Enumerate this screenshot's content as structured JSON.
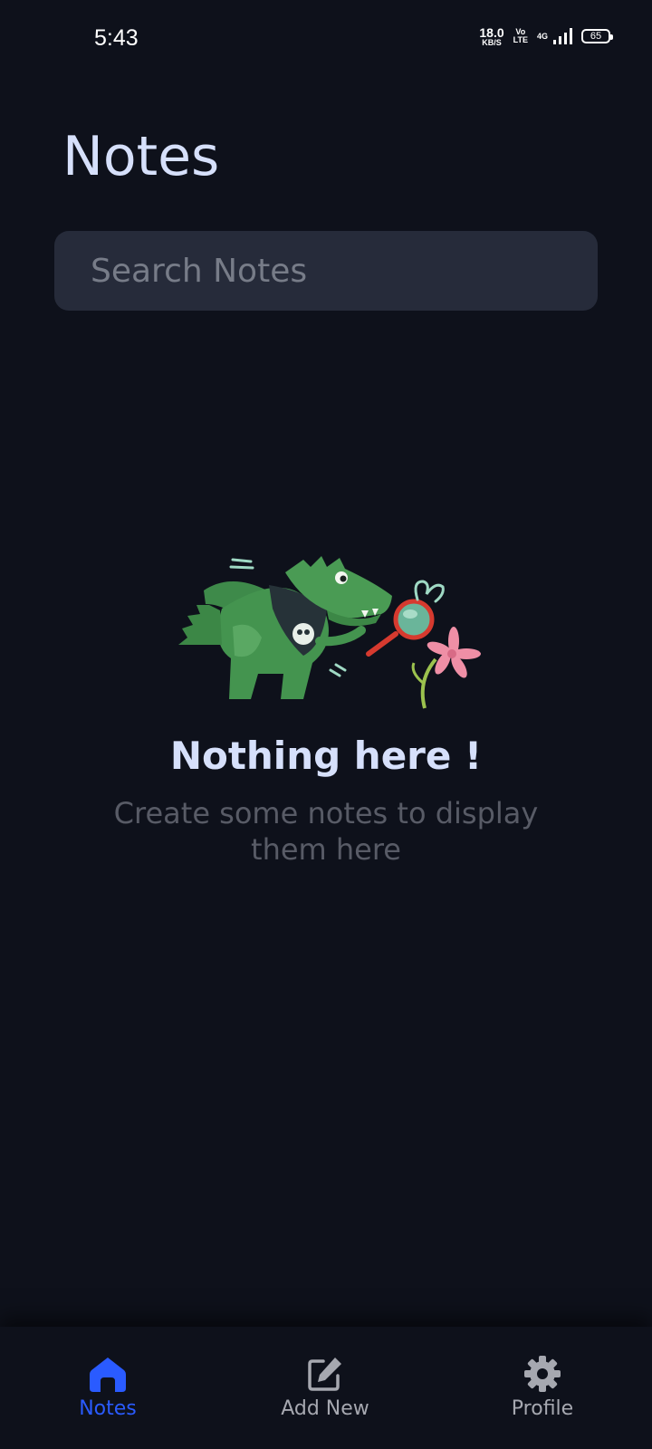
{
  "status_bar": {
    "time": "5:43",
    "net_speed_value": "18.0",
    "net_speed_unit": "KB/S",
    "volte_top": "Vo",
    "volte_bottom": "LTE",
    "network_type": "4G",
    "battery_level": "65"
  },
  "header": {
    "title": "Notes"
  },
  "search": {
    "placeholder": "Search Notes",
    "value": ""
  },
  "empty_state": {
    "illustration_icon": "dinosaur-magnifier-illustration",
    "title": "Nothing here !",
    "subtitle": "Create some notes to display them here"
  },
  "bottom_nav": {
    "items": [
      {
        "label": "Notes",
        "icon": "home-icon",
        "active": true
      },
      {
        "label": "Add New",
        "icon": "edit-note-icon",
        "active": false
      },
      {
        "label": "Profile",
        "icon": "gear-icon",
        "active": false
      }
    ]
  },
  "colors": {
    "background": "#0e111b",
    "search_background": "#262b3a",
    "title_text": "#d6e0fb",
    "muted_text": "#585b66",
    "accent": "#2a5bff",
    "nav_inactive": "#a6a8b0"
  }
}
